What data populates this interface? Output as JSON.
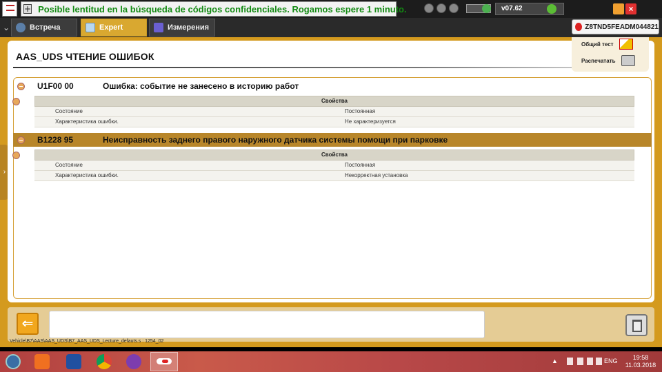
{
  "status_bar": {
    "message": "Posible lentitud en la búsqueda de códigos confidenciales. Rogamos espere 1 minuto.",
    "version": "v07.62"
  },
  "tabs": [
    {
      "label": "Встреча"
    },
    {
      "label": "Expert"
    },
    {
      "label": "Измерения"
    }
  ],
  "vin": "Z8TND5FEADM044821",
  "page_title": "AAS_UDS  ЧТЕНИЕ ОШИБОК",
  "side_menu": {
    "general_test": "Общий тест",
    "print": "Распечатать"
  },
  "faults": [
    {
      "code": "U1F00 00",
      "description": "Ошибка: событие не занесено в историю работ",
      "properties_header": "Свойства",
      "rows": [
        {
          "key": "Состояние",
          "value": "Постоянная"
        },
        {
          "key": "Характеристика ошибки.",
          "value": "Не характеризуется"
        }
      ]
    },
    {
      "code": "B1228 95",
      "description": "Неисправность заднего правого наружного датчика системы помощи при парковке",
      "properties_header": "Свойства",
      "rows": [
        {
          "key": "Состояние",
          "value": "Постоянная"
        },
        {
          "key": "Характеристика ошибки.",
          "value": "Некорректная установка"
        }
      ]
    }
  ],
  "footer_path": "Vehicle\\B7\\AAS\\AAS_UDS\\B7_AAS_UDS_Lecture_defauts.s : 1254_02",
  "taskbar": {
    "language": "ENG",
    "time": "19:58",
    "date": "11.03.2018"
  }
}
